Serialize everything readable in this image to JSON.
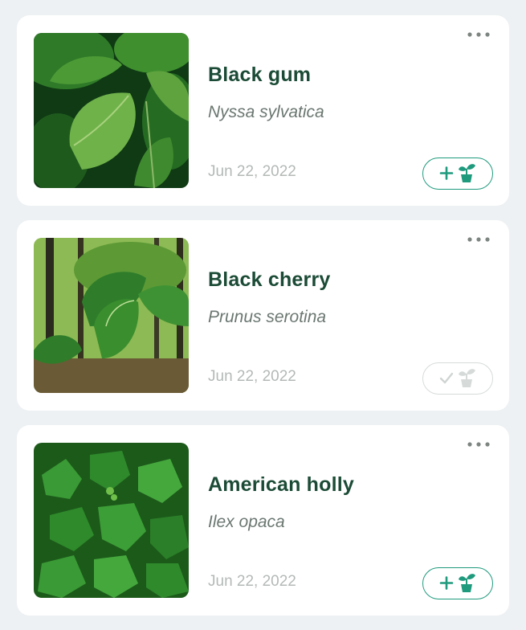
{
  "plants": [
    {
      "common_name": "Black gum",
      "scientific_name": "Nyssa sylvatica",
      "date": "Jun 22, 2022",
      "action_state": "add",
      "action_icon": "plus-plant-icon",
      "accent": "#1f9a7d"
    },
    {
      "common_name": "Black cherry",
      "scientific_name": "Prunus serotina",
      "date": "Jun 22, 2022",
      "action_state": "added",
      "action_icon": "check-plant-icon",
      "accent": "#d6dbd9"
    },
    {
      "common_name": "American holly",
      "scientific_name": "Ilex opaca",
      "date": "Jun 22, 2022",
      "action_state": "add",
      "action_icon": "plus-plant-icon",
      "accent": "#1f9a7d"
    }
  ],
  "more_icon": "more-horizontal-icon",
  "colors": {
    "title": "#1b4b36",
    "scientific": "#6b7771",
    "date": "#b3b9b6",
    "accent": "#1f9a7d",
    "background": "#eef1f3"
  }
}
